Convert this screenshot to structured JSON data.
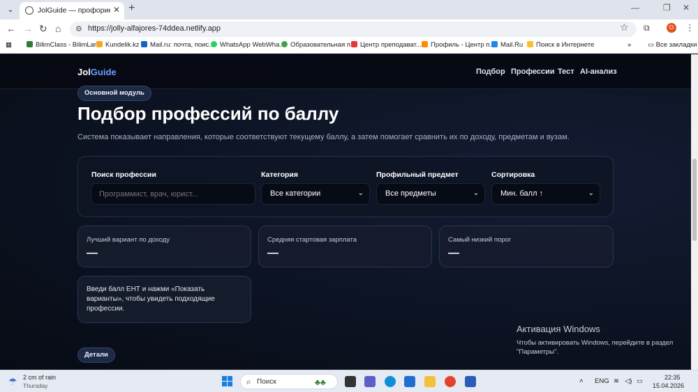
{
  "browser": {
    "tab_title": "JolGuide — профориентация и",
    "url": "https://jolly-alfajores-74ddea.netlify.app",
    "profile_initial": "O",
    "bookmarks": [
      {
        "label": "BilimClass - BilimLand",
        "color": "#2e7d32"
      },
      {
        "label": "Kundelik.kz",
        "color": "#f5a623"
      },
      {
        "label": "Mail.ru: почта, поис...",
        "color": "#1565c0"
      },
      {
        "label": "WhatsApp WebWha...",
        "color": "#25d366"
      },
      {
        "label": "Образовательная п...",
        "color": "#43a047"
      },
      {
        "label": "Центр преподават...",
        "color": "#e53935"
      },
      {
        "label": "Профиль - Центр п...",
        "color": "#fb8c00"
      },
      {
        "label": "Mail.Ru",
        "color": "#1e88e5"
      },
      {
        "label": "Поиск в Интернете",
        "color": "#fbc02d"
      }
    ],
    "all_bookmarks": "Все закладки"
  },
  "site": {
    "logo_main": "Jol",
    "logo_accent": "Guide",
    "nav": [
      "Подбор",
      "Профессии",
      "Тест",
      "AI-анализ"
    ]
  },
  "section": {
    "badge": "Основной модуль",
    "title": "Подбор профессий по баллу",
    "subtitle": "Система показывает направления, которые соответствуют текущему баллу, а затем помогает сравнить их по доходу, предметам и вузам."
  },
  "filters": {
    "search_label": "Поиск профессии",
    "search_placeholder": "Программист, врач, юрист...",
    "category_label": "Категория",
    "category_value": "Все категории",
    "subject_label": "Профильный предмет",
    "subject_value": "Все предметы",
    "sort_label": "Сортировка",
    "sort_value": "Мин. балл ↑"
  },
  "stats": [
    {
      "label": "Лучший вариант по доходу",
      "value": "—"
    },
    {
      "label": "Средняя стартовая зарплата",
      "value": "—"
    },
    {
      "label": "Самый низкий порог",
      "value": "—"
    }
  ],
  "hint": "Введи балл ЕНТ и нажми «Показать варианты», чтобы увидеть подходящие профессии.",
  "details_badge": "Детали",
  "activation": {
    "title": "Активация Windows",
    "line1": "Чтобы активировать Windows, перейдите в раздел",
    "line2": "\"Параметры\"."
  },
  "taskbar": {
    "weather_main": "2 cm of rain",
    "weather_sub": "Thursday",
    "search": "Поиск",
    "lang": "ENG",
    "time": "22:35",
    "date": "15.04.2026"
  }
}
